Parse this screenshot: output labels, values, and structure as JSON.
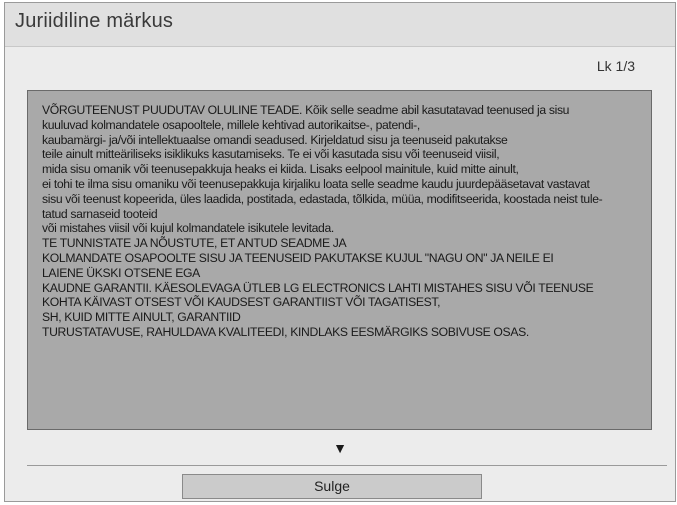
{
  "dialog": {
    "title": "Juriidiline märkus",
    "page_indicator": "Lk 1/3",
    "notice_lines": [
      "VÕRGUTEENUST PUUDUTAV OLULINE TEADE. Kõik selle seadme abil kasutatavad teenused ja sisu",
      "kuuluvad kolmandatele osapooltele, millele kehtivad autorikaitse-, patendi-,",
      "kaubamärgi- ja/või intellektuaalse omandi seadused. Kirjeldatud sisu ja teenuseid pakutakse",
      "teile ainult mitteäriliseks isiklikuks kasutamiseks. Te ei või kasutada sisu või teenuseid  viisil,",
      "mida sisu omanik või teenusepakkuja heaks ei kiida. Lisaks eelpool mainitule, kuid mitte ainult,",
      "ei tohi te ilma sisu omaniku või teenusepakkuja kirjaliku loata selle seadme kaudu juurdepääsetavat vastavat",
      "sisu või teenust kopeerida, üles laadida, postitada, edastada, tõlkida, müüa, modifitseerida, koostada neist tule-",
      "tatud sarnaseid tooteid",
      "või mistahes viisil või kujul kolmandatele isikutele levitada.",
      "TE TUNNISTATE JA NÕUSTUTE, ET ANTUD SEADME JA",
      "KOLMANDATE OSAPOOLTE SISU JA TEENUSEID PAKUTAKSE KUJUL \"NAGU ON\" JA NEILE EI",
      "LAIENE ÜKSKI OTSENE EGA",
      "KAUDNE GARANTII. KÄESOLEVAGA ÜTLEB LG ELECTRONICS LAHTI MISTAHES SISU VÕI TEENUSE",
      "KOHTA KÄIVAST OTSEST VÕI KAUDSEST GARANTIIST VÕI TAGATISEST,",
      "SH, KUID MITTE AINULT, GARANTIID",
      "TURUSTATAVUSE, RAHULDAVA KVALITEEDI, KINDLAKS EESMÄRGIKS SOBIVUSE OSAS."
    ],
    "scroll_indicator": "▼",
    "close_label": "Sulge"
  },
  "icons": {
    "scroll_down": "triangle-down-icon"
  },
  "colors": {
    "dialog_background": "#ececec",
    "title_bar": "#e0e0e0",
    "notice_background": "#a9a9a9",
    "button_background": "#cbcbcb"
  }
}
